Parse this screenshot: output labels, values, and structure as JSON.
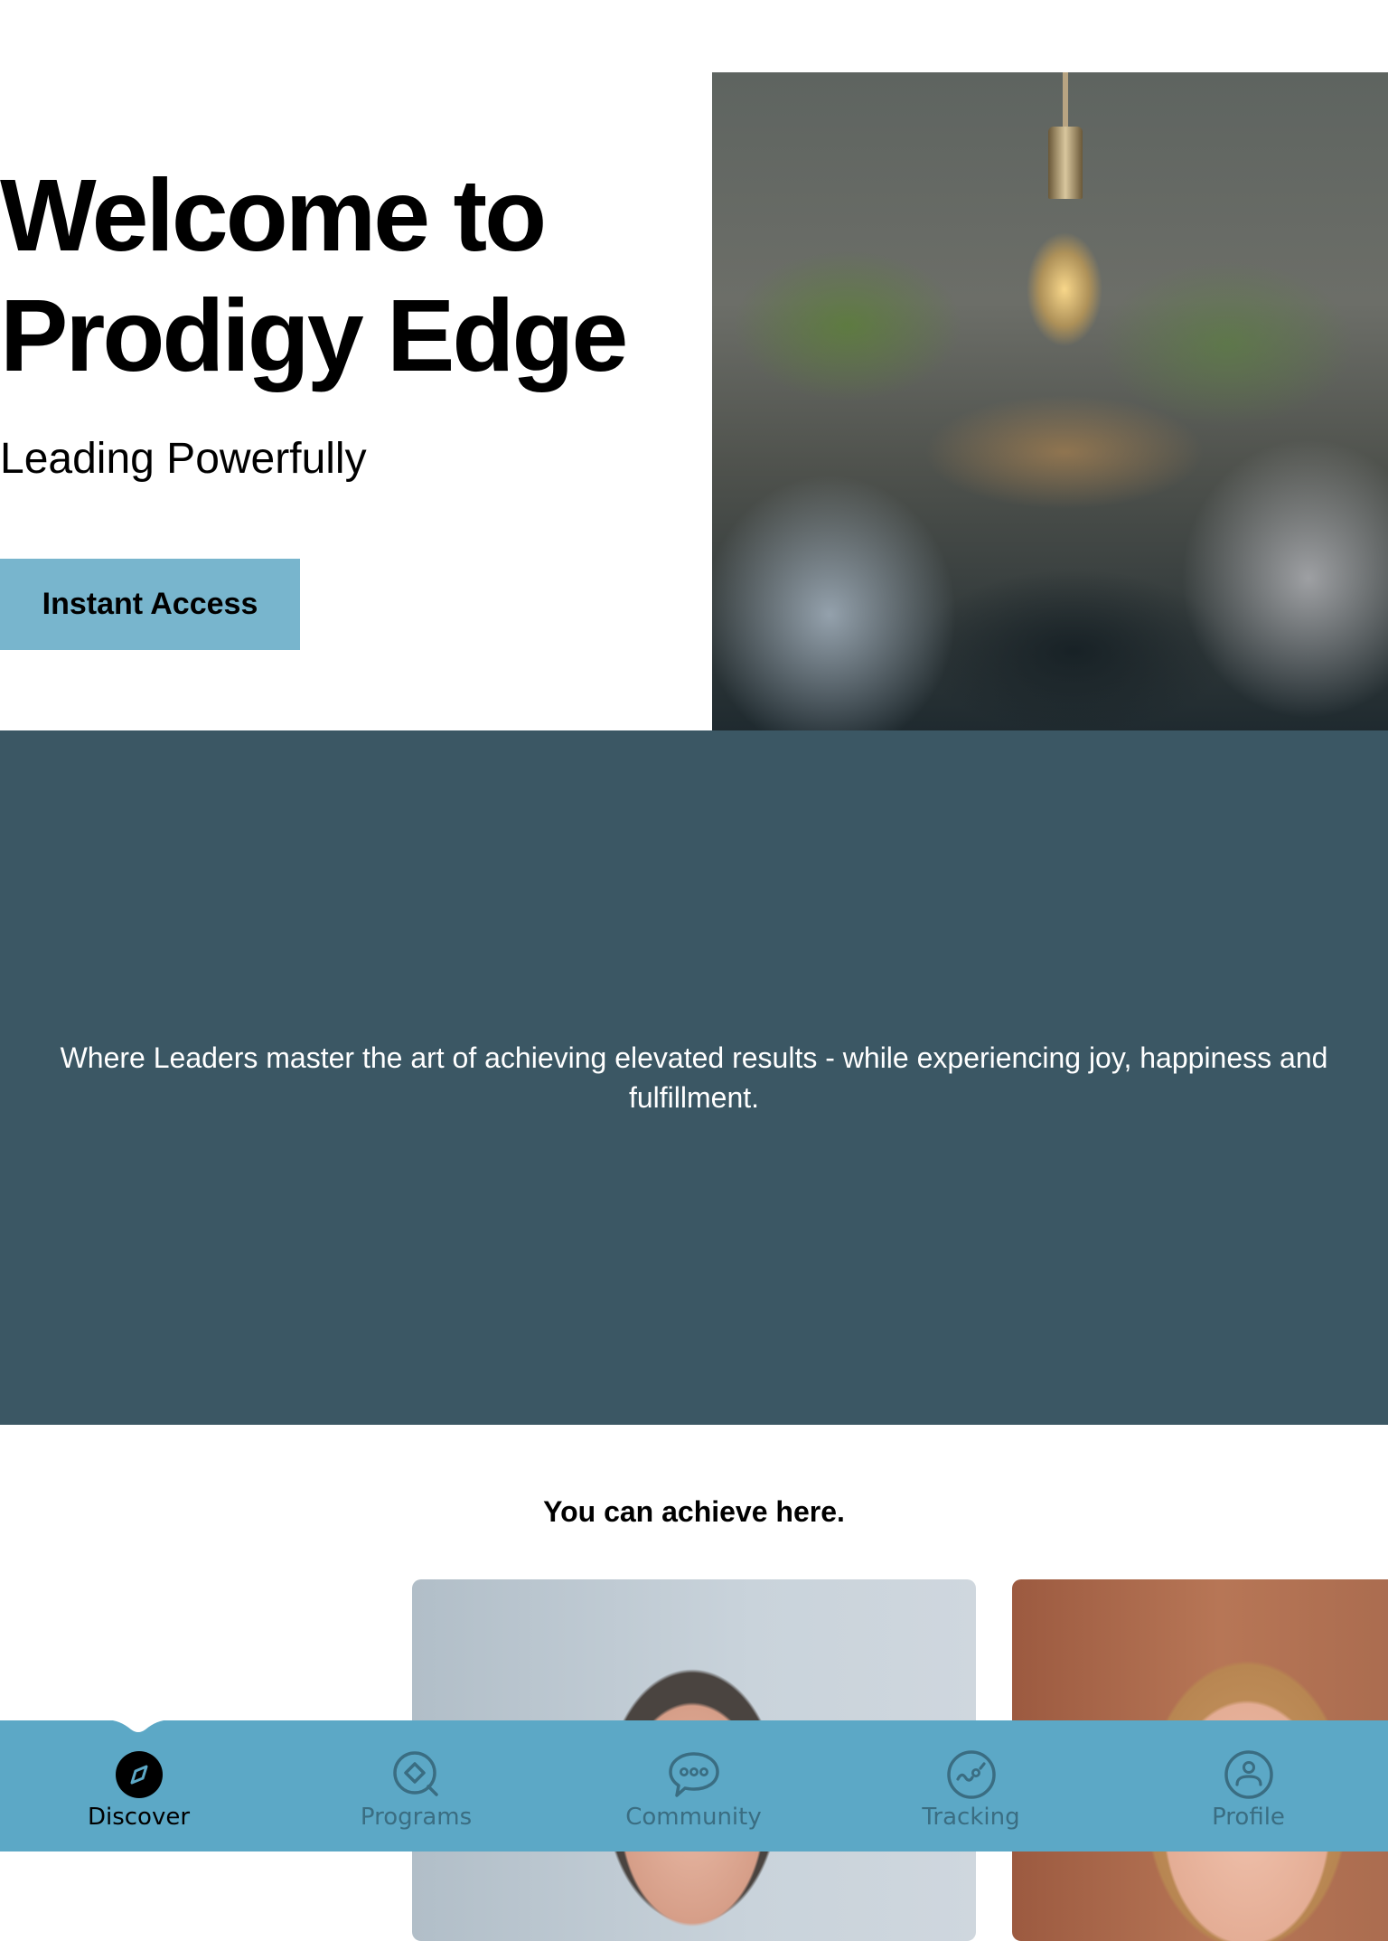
{
  "hero": {
    "title": "Welcome to\nProdigy Edge",
    "subtitle": "Leading Powerfully",
    "cta_label": "Instant Access",
    "image_alt": "Team meeting under a hanging light bulb"
  },
  "banner": {
    "text": "Where Leaders master the art of achieving elevated results - while experiencing joy, happiness and fulfillment."
  },
  "achieve": {
    "title": "You can achieve here.",
    "cards": [
      {
        "image_alt": "Portrait of a man"
      },
      {
        "image_alt": "Portrait of a woman"
      }
    ]
  },
  "nav": {
    "items": [
      {
        "label": "Discover",
        "icon": "compass-icon",
        "active": true
      },
      {
        "label": "Programs",
        "icon": "search-diamond-icon",
        "active": false
      },
      {
        "label": "Community",
        "icon": "chat-bubble-icon",
        "active": false
      },
      {
        "label": "Tracking",
        "icon": "tracking-chart-icon",
        "active": false
      },
      {
        "label": "Profile",
        "icon": "user-circle-icon",
        "active": false
      }
    ]
  },
  "colors": {
    "accent": "#78b5cd",
    "banner_bg": "#3b5764",
    "nav_bg": "#5ca8c6",
    "nav_inactive": "#3a6d82",
    "nav_active": "#000000"
  }
}
